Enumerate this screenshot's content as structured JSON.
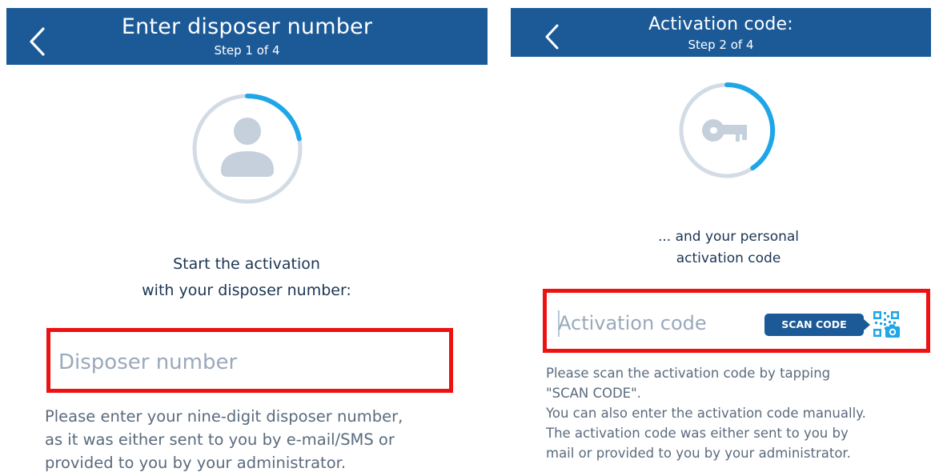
{
  "colors": {
    "header_bg": "#1c5a97",
    "progress_arc": "#1fa6e8",
    "ring": "#d3dce5",
    "silhouette": "#c5d0dc",
    "highlight_frame": "#ee1111"
  },
  "step1": {
    "header": {
      "title": "Enter disposer number",
      "step": "Step 1 of 4",
      "back_icon": "chevron-left-icon"
    },
    "progress": {
      "current_step": 1,
      "total_steps": 4,
      "icon": "person-icon"
    },
    "intro": {
      "line1": "Start the activation",
      "line2": "with your disposer number:"
    },
    "field": {
      "placeholder": "Disposer number",
      "value": ""
    },
    "help": {
      "line1": "Please enter your nine-digit disposer number,",
      "line2": "as it was either sent to you by e-mail/SMS or",
      "line3": "provided to you by your administrator."
    }
  },
  "step2": {
    "header": {
      "title": "Activation code:",
      "step": "Step 2 of 4",
      "back_icon": "chevron-left-icon"
    },
    "progress": {
      "current_step": 2,
      "total_steps": 4,
      "icon": "key-icon"
    },
    "intro": {
      "line1": "... and your personal",
      "line2": "activation code"
    },
    "field": {
      "placeholder": "Activation code",
      "value": ""
    },
    "scan_button": {
      "label": "SCAN CODE",
      "icon": "qr-camera-icon"
    },
    "help": {
      "line1": "Please scan the activation code by tapping",
      "line2": "\"SCAN CODE\".",
      "line3": "You can also enter the activation code manually.",
      "line4": "The activation code was either sent to you by",
      "line5": "mail or provided to you by your administrator."
    }
  }
}
